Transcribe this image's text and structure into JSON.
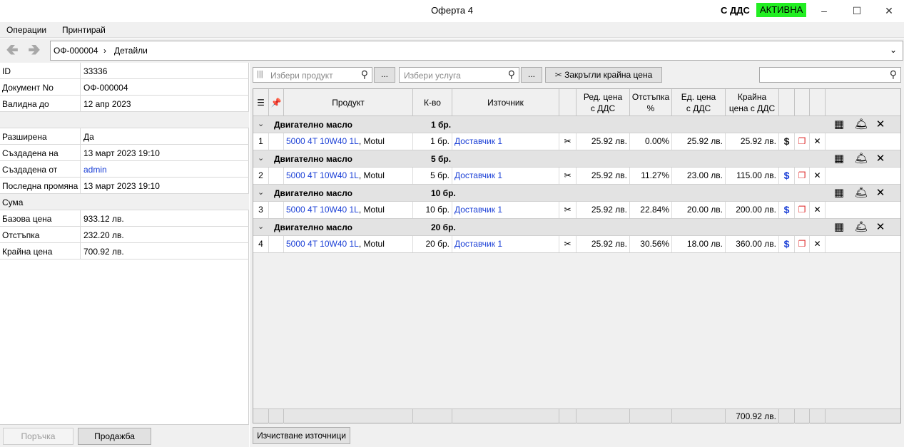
{
  "window": {
    "title": "Оферта 4",
    "vat_label": "С ДДС",
    "status_label": "АКТИВНА",
    "status_color": "#22ee22",
    "minimize_icon": "minimize-icon",
    "maximize_icon": "maximize-icon",
    "close_icon": "close-icon"
  },
  "menu": {
    "operations": "Операции",
    "print": "Принтирай"
  },
  "nav": {
    "crumb_doc": "ОФ-000004",
    "crumb_sep": "›",
    "crumb_page": "Детайли"
  },
  "props": {
    "id": {
      "label": "ID",
      "value": "33336"
    },
    "doc_no": {
      "label": "Документ No",
      "value": "ОФ-000004"
    },
    "valid_until": {
      "label": "Валидна до",
      "value": "12 апр 2023"
    },
    "extended": {
      "label": "Разширена",
      "value": "Да"
    },
    "created_on": {
      "label": "Създадена на",
      "value": "13 март 2023 19:10"
    },
    "created_by": {
      "label": "Създадена от",
      "value": "admin"
    },
    "last_changed": {
      "label": "Последна промяна",
      "value": "13 март 2023 19:10"
    },
    "sum_section": "Сума",
    "base_price": {
      "label": "Базова цена",
      "value": "933.12 лв."
    },
    "discount": {
      "label": "Отстъпка",
      "value": "232.20 лв."
    },
    "final_price": {
      "label": "Крайна цена",
      "value": "700.92 лв."
    }
  },
  "left_footer": {
    "order_button": "Поръчка",
    "sale_button": "Продажба"
  },
  "toolbar": {
    "product_placeholder": "Избери продукт",
    "service_placeholder": "Избери услуга",
    "dots": "...",
    "round_button": "Закръгли крайна цена"
  },
  "grid": {
    "headers": {
      "product": "Продукт",
      "qty": "К-во",
      "source": "Източник",
      "row_price": "Ред. цена с ДДС",
      "discount": "Отстъпка %",
      "unit_price": "Ед. цена с ДДС",
      "final_price": "Крайна цена с ДДС"
    },
    "groups": [
      {
        "name": "Двигателно масло",
        "qty": "1 бр."
      },
      {
        "name": "Двигателно масло",
        "qty": "5 бр."
      },
      {
        "name": "Двигателно масло",
        "qty": "10 бр."
      },
      {
        "name": "Двигателно масло",
        "qty": "20 бр."
      }
    ],
    "rows": [
      {
        "num": "1",
        "product": "5000 4T 10W40 1L",
        "brand": ", Motul",
        "qty": "1 бр.",
        "source": "Доставчик 1",
        "row_price": "25.92 лв.",
        "discount": "0.00%",
        "unit_price": "25.92 лв.",
        "final_price": "25.92 лв."
      },
      {
        "num": "2",
        "product": "5000 4T 10W40 1L",
        "brand": ", Motul",
        "qty": "5 бр.",
        "source": "Доставчик 1",
        "row_price": "25.92 лв.",
        "discount": "11.27%",
        "unit_price": "23.00 лв.",
        "final_price": "115.00 лв."
      },
      {
        "num": "3",
        "product": "5000 4T 10W40 1L",
        "brand": ", Motul",
        "qty": "10 бр.",
        "source": "Доставчик 1",
        "row_price": "25.92 лв.",
        "discount": "22.84%",
        "unit_price": "20.00 лв.",
        "final_price": "200.00 лв."
      },
      {
        "num": "4",
        "product": "5000 4T 10W40 1L",
        "brand": ", Motul",
        "qty": "20 бр.",
        "source": "Доставчик 1",
        "row_price": "25.92 лв.",
        "discount": "30.56%",
        "unit_price": "18.00 лв.",
        "final_price": "360.00 лв."
      }
    ],
    "footer_total": "700.92 лв."
  },
  "bottom": {
    "clear_sources_button": "Изчистване източници"
  },
  "icons": {
    "back": "back-arrow-icon",
    "forward": "forward-arrow-icon",
    "search": "search-icon",
    "barcode": "barcode-icon",
    "pin": "pin-icon",
    "list": "list-icon",
    "grid": "grid-icon",
    "service": "service-bell-icon",
    "remove": "remove-icon",
    "price": "dollar-icon",
    "copy": "copy-icon",
    "price_tag": "price-tag-icon",
    "chevron": "chevron-down-icon"
  }
}
